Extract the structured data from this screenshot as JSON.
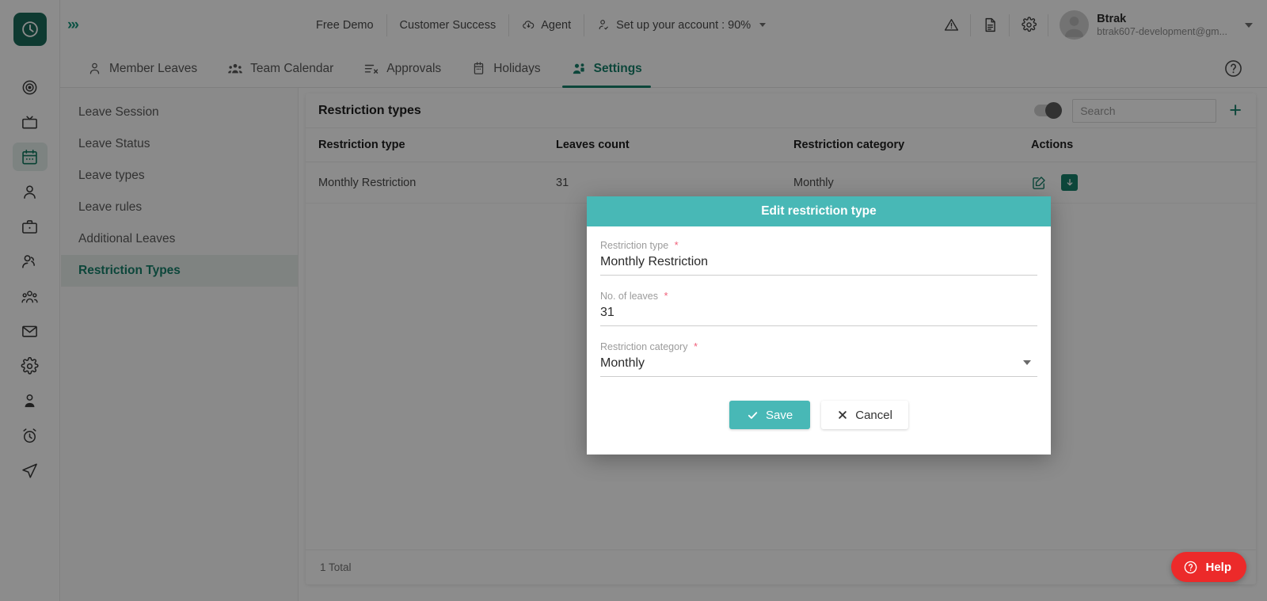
{
  "brand": {
    "logo_icon": "clock-icon",
    "logo_color": "#1b6b5a",
    "accent_color": "#17806a",
    "modal_accent_color": "#48b8b6",
    "danger_color": "#ec2a2a",
    "expander_label": "›››"
  },
  "header": {
    "buttons": [
      {
        "label": "Free Demo",
        "icon": ""
      },
      {
        "label": "Customer Success",
        "icon": ""
      },
      {
        "label": "Agent",
        "icon": "cloud-download-icon"
      },
      {
        "label": "Set up your account : 90%",
        "icon": "user-check-icon"
      }
    ],
    "icons": [
      {
        "name": "warning-triangle-icon"
      },
      {
        "name": "document-icon"
      },
      {
        "name": "gear-icon"
      }
    ],
    "user": {
      "name": "Btrak",
      "email": "btrak607-development@gm...",
      "avatar_icon": "avatar-icon"
    }
  },
  "tabs": [
    {
      "label": "Member Leaves",
      "icon": "person-icon",
      "active": false
    },
    {
      "label": "Team Calendar",
      "icon": "group-icon",
      "active": false
    },
    {
      "label": "Approvals",
      "icon": "list-check-icon",
      "active": false
    },
    {
      "label": "Holidays",
      "icon": "calendar-icon",
      "active": false
    },
    {
      "label": "Settings",
      "icon": "people-settings-icon",
      "active": true
    }
  ],
  "tabbar_help_icon": "question-circle-icon",
  "rail_items": [
    {
      "icon": "target-icon",
      "active": false
    },
    {
      "icon": "tv-icon",
      "active": false
    },
    {
      "icon": "calendar-icon",
      "active": true
    },
    {
      "icon": "person-icon",
      "active": false
    },
    {
      "icon": "briefcase-icon",
      "active": false
    },
    {
      "icon": "user-group-icon",
      "active": false
    },
    {
      "icon": "people-icon",
      "active": false
    },
    {
      "icon": "mail-icon",
      "active": false
    },
    {
      "icon": "gear-icon",
      "active": false
    },
    {
      "icon": "user-tie-icon",
      "active": false
    },
    {
      "icon": "alarm-clock-icon",
      "active": false
    },
    {
      "icon": "paper-plane-icon",
      "active": false
    }
  ],
  "subnav": {
    "items": [
      {
        "label": "Leave Session",
        "active": false
      },
      {
        "label": "Leave Status",
        "active": false
      },
      {
        "label": "Leave types",
        "active": false
      },
      {
        "label": "Leave rules",
        "active": false
      },
      {
        "label": "Additional Leaves",
        "active": false
      },
      {
        "label": "Restriction Types",
        "active": true
      }
    ]
  },
  "panel": {
    "title": "Restriction types",
    "search_placeholder": "Search",
    "search_value": "",
    "toggle_on": true,
    "add_label": "+",
    "columns": [
      "Restriction type",
      "Leaves count",
      "Restriction category",
      "Actions"
    ],
    "rows": [
      {
        "restriction_type": "Monthly Restriction",
        "leaves_count": "31",
        "restriction_category": "Monthly",
        "actions": [
          "edit-icon",
          "archive-down-icon"
        ]
      }
    ],
    "footer_total": "1 Total"
  },
  "modal": {
    "title": "Edit restriction type",
    "fields": [
      {
        "label": "Restriction type",
        "required": "*",
        "value": "Monthly Restriction",
        "type": "text"
      },
      {
        "label": "No. of leaves",
        "required": "*",
        "value": "31",
        "type": "text"
      },
      {
        "label": "Restriction category",
        "required": "*",
        "value": "Monthly",
        "type": "select"
      }
    ],
    "save_label": "Save",
    "cancel_label": "Cancel"
  },
  "help_widget": {
    "label": "Help",
    "icon": "question-circle-icon"
  }
}
